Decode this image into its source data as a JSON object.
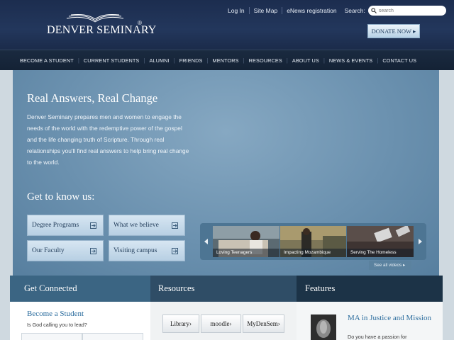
{
  "header": {
    "logo_text": "DENVER SEMINARY",
    "logo_mark": "®",
    "utility_links": [
      "Log In",
      "Site Map",
      "eNews registration"
    ],
    "search": {
      "label": "Search:",
      "placeholder": "search"
    },
    "donate_label": "DONATE NOW ▸"
  },
  "nav": {
    "items": [
      "BECOME A STUDENT",
      "CURRENT STUDENTS",
      "ALUMNI",
      "FRIENDS",
      "MENTORS",
      "RESOURCES",
      "ABOUT US",
      "NEWS & EVENTS",
      "CONTACT US"
    ]
  },
  "hero": {
    "title": "Real Answers, Real Change",
    "text": "Denver Seminary prepares men and women to engage the needs of the world with the redemptive power of the gospel and the life changing truth of Scripture. Through real relationships you'll find real answers to help bring real change to the world.",
    "subtitle": "Get to know us:",
    "buttons": [
      "Degree Programs",
      "What we believe",
      "Our Faculty",
      "Visiting campus"
    ],
    "videos": [
      "Loving Teenagers",
      "Impacting Mozambique",
      "Serving The Homeless"
    ],
    "see_all": "See all videos ▸"
  },
  "sections": {
    "get_connected": {
      "heading": "Get Connected",
      "title": "Become a Student",
      "subtitle": "Is God calling you to lead?"
    },
    "resources": {
      "heading": "Resources",
      "buttons": [
        "Library›",
        "moodle›",
        "MyDenSem›"
      ]
    },
    "features": {
      "heading": "Features",
      "title": "MA in Justice and Mission",
      "text": "Do you have a passion for"
    }
  },
  "colors": {
    "header_bg": "#1c2d4f",
    "nav_bg": "#1a2a40",
    "hero_bg": "#6b91af",
    "section_head_1": "#3b6583",
    "section_head_2": "#2f4d66",
    "section_head_3": "#1c3347",
    "link_blue": "#2c6d9e"
  }
}
